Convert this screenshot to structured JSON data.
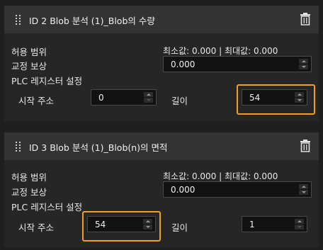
{
  "panels": [
    {
      "title": "ID 2  Blob 분석 (1)_Blob의 수량",
      "tolerance_label": "허용 범위",
      "range_text": "최소값: 0.000 | 최대값: 0.000",
      "calibration_label": "교정 보상",
      "calibration_value": "0.000",
      "plc_label": "PLC 레지스터 설정",
      "start_label": "시작 주소",
      "start_value": "0",
      "length_label": "길이",
      "length_value": "54",
      "highlighted_field": "length"
    },
    {
      "title": "ID 3  Blob 분석 (1)_Blob(n)의 면적",
      "tolerance_label": "허용 범위",
      "range_text": "최소값: 0.000 | 최대값: 0.000",
      "calibration_label": "교정 보상",
      "calibration_value": "0.000",
      "plc_label": "PLC 레지스터 설정",
      "start_label": "시작 주소",
      "start_value": "54",
      "length_label": "길이",
      "length_value": "1",
      "highlighted_field": "start"
    }
  ],
  "icons": {
    "drag": "drag-handle-icon",
    "delete": "trash-icon"
  },
  "colors": {
    "highlight": "#f0a020",
    "background": "#1f1f1f",
    "header": "#333333"
  }
}
